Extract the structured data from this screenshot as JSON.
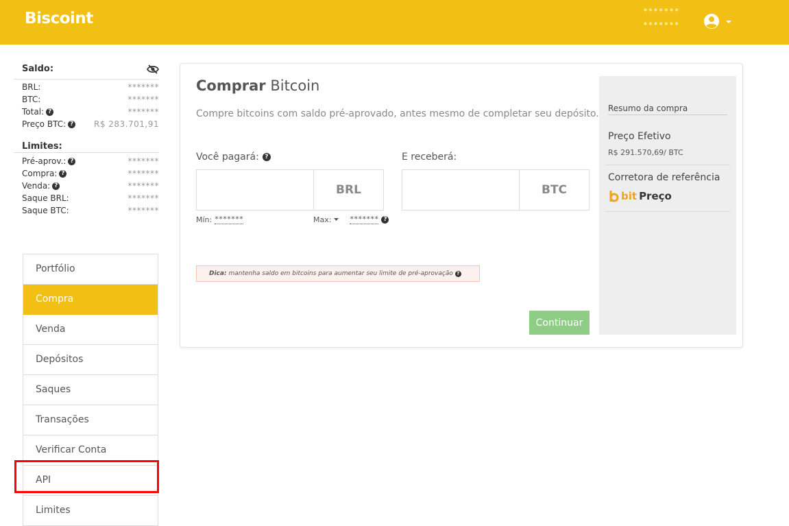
{
  "header": {
    "brand": "Biscoint",
    "user_line1": "*******",
    "user_line2": "*******",
    "accent_color": "#f2c014"
  },
  "balances": {
    "title": "Saldo:",
    "rows": [
      {
        "label": "BRL:",
        "value": "*******"
      },
      {
        "label": "BTC:",
        "value": "*******"
      },
      {
        "label": "Total:",
        "value": "*******"
      },
      {
        "label": "Preço BTC:",
        "value": "R$ 283.701,91"
      }
    ]
  },
  "limits": {
    "title": "Limites:",
    "rows": [
      {
        "label": "Pré-aprov.:",
        "value": "*******"
      },
      {
        "label": "Compra:",
        "value": "*******"
      },
      {
        "label": "Venda:",
        "value": "*******"
      },
      {
        "label": "Saque BRL:",
        "value": "*******"
      },
      {
        "label": "Saque BTC:",
        "value": "*******"
      }
    ]
  },
  "menu": {
    "items": [
      {
        "label": "Portfólio"
      },
      {
        "label": "Compra"
      },
      {
        "label": "Venda"
      },
      {
        "label": "Depósitos"
      },
      {
        "label": "Saques"
      },
      {
        "label": "Transações"
      },
      {
        "label": "Verificar Conta"
      },
      {
        "label": "API"
      },
      {
        "label": "Limites"
      }
    ],
    "active": "Compra"
  },
  "buy": {
    "title_bold": "Comprar",
    "title_rest": "Bitcoin",
    "subtitle": "Compre bitcoins com saldo pré-aprovado, antes mesmo de completar seu depósito.",
    "pay_label": "Você pagará:",
    "pay_currency": "BRL",
    "receive_label": "E receberá:",
    "receive_currency": "BTC",
    "min_label": "Mín:",
    "min_value": "*******",
    "max_label": "Max:",
    "max_value": "*******",
    "tip_bold": "Dica:",
    "tip_text": "mantenha saldo em bitcoins para aumentar seu limite de pré-aprovação",
    "continue_label": "Continuar"
  },
  "summary": {
    "title": "Resumo da compra",
    "effective_label": "Preço Efetivo",
    "effective_value": "R$ 291.570,69/ BTC",
    "broker_label": "Corretora de referência",
    "broker_logo_bit": "bit",
    "broker_logo_preco": "Preço"
  }
}
